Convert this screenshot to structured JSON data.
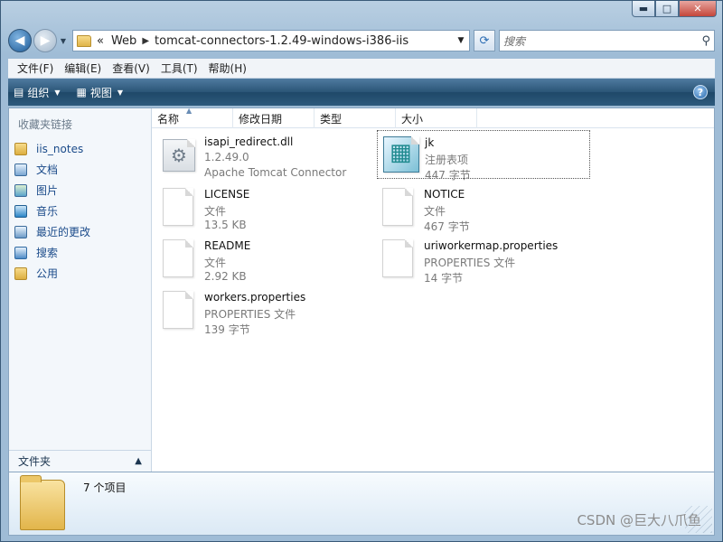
{
  "window": {
    "close_glyph": "✕",
    "max_glyph": "□",
    "min_glyph": "▬"
  },
  "address": {
    "prefix": "«",
    "crumbs": [
      "Web",
      "tomcat-connectors-1.2.49-windows-i386-iis"
    ]
  },
  "search": {
    "placeholder": "搜索"
  },
  "menu": [
    "文件(F)",
    "编辑(E)",
    "查看(V)",
    "工具(T)",
    "帮助(H)"
  ],
  "commands": {
    "organize": "组织",
    "view": "视图"
  },
  "sidebar": {
    "heading": "收藏夹链接",
    "items": [
      {
        "label": "iis_notes",
        "icon": "folder-icon"
      },
      {
        "label": "文档",
        "icon": "documents-icon"
      },
      {
        "label": "图片",
        "icon": "pictures-icon"
      },
      {
        "label": "音乐",
        "icon": "music-icon"
      },
      {
        "label": "最近的更改",
        "icon": "recent-changes-icon"
      },
      {
        "label": "搜索",
        "icon": "search-icon"
      },
      {
        "label": "公用",
        "icon": "folder-icon"
      }
    ],
    "folders_label": "文件夹"
  },
  "columns": [
    "名称",
    "修改日期",
    "类型",
    "大小"
  ],
  "files": [
    {
      "name": "isapi_redirect.dll",
      "line2": "1.2.49.0",
      "line3": "Apache Tomcat Connector",
      "kind": "dll"
    },
    {
      "name": "jk",
      "line2": "注册表项",
      "line3": "447 字节",
      "kind": "reg"
    },
    {
      "name": "LICENSE",
      "line2": "文件",
      "line3": "13.5 KB",
      "kind": "doc"
    },
    {
      "name": "NOTICE",
      "line2": "文件",
      "line3": "467 字节",
      "kind": "doc"
    },
    {
      "name": "README",
      "line2": "文件",
      "line3": "2.92 KB",
      "kind": "doc"
    },
    {
      "name": "uriworkermap.properties",
      "line2": "PROPERTIES 文件",
      "line3": "14 字节",
      "kind": "doc"
    },
    {
      "name": "workers.properties",
      "line2": "PROPERTIES 文件",
      "line3": "139 字节",
      "kind": "doc"
    }
  ],
  "details": {
    "item_count": "7 个项目"
  },
  "watermark": "CSDN @巨大八爪鱼"
}
